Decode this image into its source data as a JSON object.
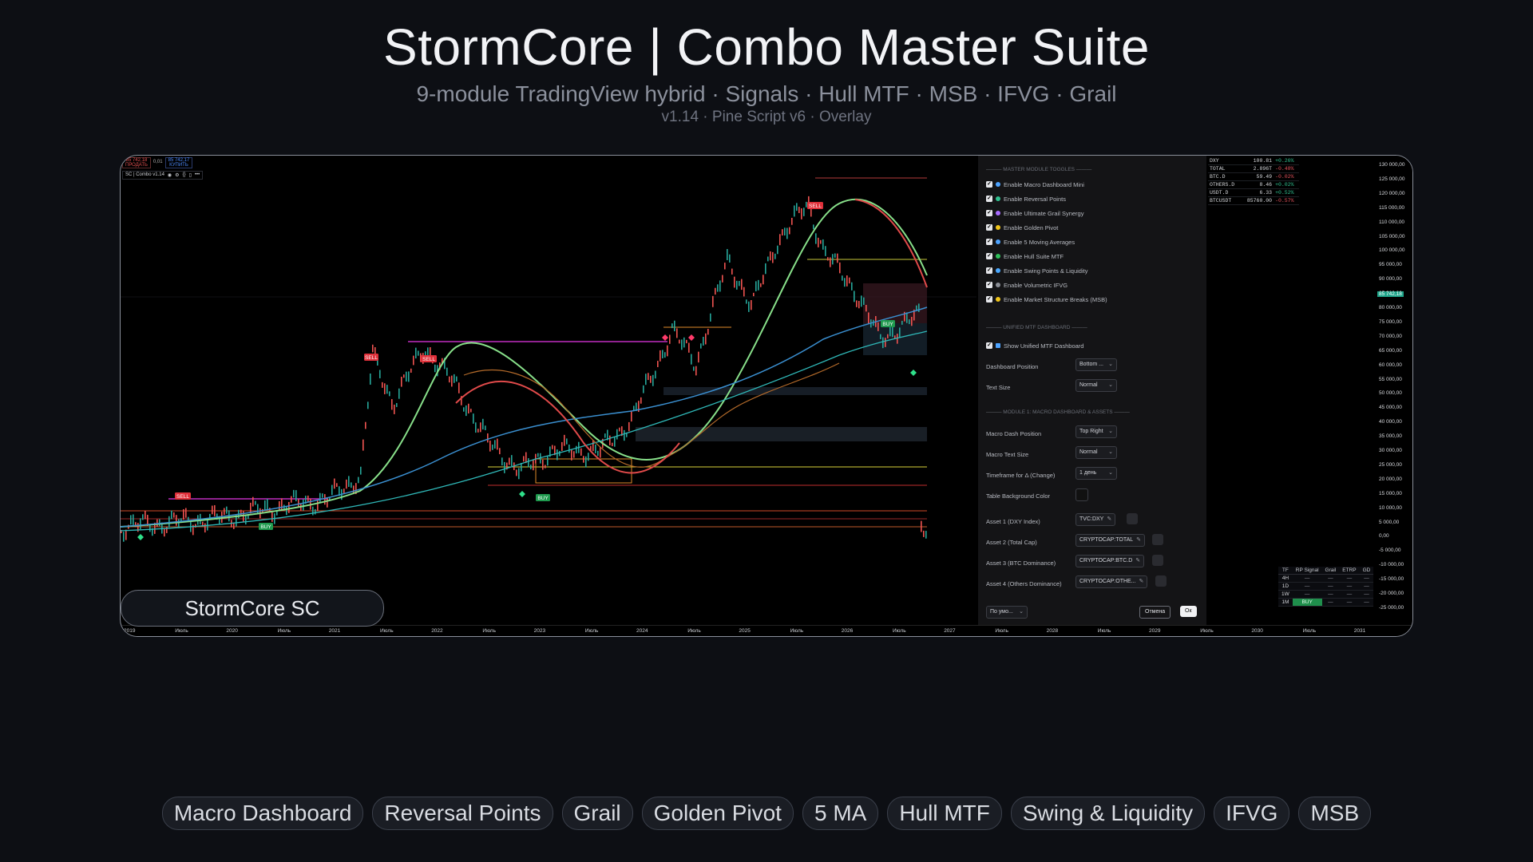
{
  "hero": {
    "title": "StormCore | Combo Master Suite",
    "subtitle": "9-module TradingView hybrid  ·  Signals · Hull MTF · MSB · IFVG · Grail",
    "meta": "v1.14  ·  Pine Script v6  ·  Overlay"
  },
  "tv": {
    "sell_price": "85 742,18",
    "sell_label": "ПРОДАТЬ",
    "spread": "0,01",
    "buy_price": "85 742,17",
    "buy_label": "КУПИТЬ",
    "indicator": "SC | Combo v1.14",
    "current_price_tag": "85 742,18"
  },
  "chart_signals": [
    "SELL",
    "SELL",
    "SELL",
    "SELL",
    "BUY",
    "BUY",
    "BUY"
  ],
  "settings": {
    "sec_master": "——— MASTER MODULE TOGGLES ———",
    "toggles": [
      {
        "icon": "chart-icon",
        "color": "#4da3ff",
        "label": "Enable Macro Dashboard Mini"
      },
      {
        "icon": "circle-green-icon",
        "color": "#2fbf8e",
        "label": "Enable Reversal Points"
      },
      {
        "icon": "square-purple-icon",
        "color": "#a86bff",
        "label": "Enable Ultimate Grail Synergy"
      },
      {
        "icon": "circle-yellow-icon",
        "color": "#f0c419",
        "label": "Enable Golden Pivot"
      },
      {
        "icon": "chart-icon",
        "color": "#4da3ff",
        "label": "Enable 5 Moving Averages"
      },
      {
        "icon": "square-green-icon",
        "color": "#2fbf5a",
        "label": "Enable Hull Suite MTF"
      },
      {
        "icon": "drop-icon",
        "color": "#4aa8ff",
        "label": "Enable Swing Points & Liquidity"
      },
      {
        "icon": "circle-grey-icon",
        "color": "#8a8d95",
        "label": "Enable Volumetric IFVG"
      },
      {
        "icon": "bolt-icon",
        "color": "#f0c419",
        "label": "Enable Market Structure Breaks (MSB)"
      }
    ],
    "sec_mtf": "——— UNIFIED MTF DASHBOARD ———",
    "show_mtf": "Show Unified MTF Dashboard",
    "dash_pos_label": "Dashboard Position",
    "dash_pos_value": "Bottom ...",
    "text_size_label": "Text Size",
    "text_size_value": "Normal",
    "sec_macro": "——— MODULE 1: MACRO DASHBOARD & ASSETS ———",
    "macro_pos_label": "Macro Dash Position",
    "macro_pos_value": "Top Right",
    "macro_text_label": "Macro Text Size",
    "macro_text_value": "Normal",
    "tf_label": "Timeframe for Δ (Change)",
    "tf_value": "1 день",
    "bg_label": "Table Background Color",
    "assets": [
      {
        "label": "Asset 1 (DXY Index)",
        "value": "TVC:DXY"
      },
      {
        "label": "Asset 2 (Total Cap)",
        "value": "CRYPTOCAP:TOTAL"
      },
      {
        "label": "Asset 3 (BTC Dominance)",
        "value": "CRYPTOCAP:BTC.D"
      },
      {
        "label": "Asset 4 (Others Dominance)",
        "value": "CRYPTOCAP:OTHE..."
      }
    ],
    "defaults": "По умо...",
    "cancel": "Отмена",
    "ok": "Ок"
  },
  "macro": [
    {
      "name": "DXY",
      "value": "100.81",
      "change": "+0.26%",
      "dir": "pos"
    },
    {
      "name": "TOTAL",
      "value": "2.896T",
      "change": "-0.48%",
      "dir": "neg"
    },
    {
      "name": "BTC.D",
      "value": "59.49",
      "change": "-0.02%",
      "dir": "neg"
    },
    {
      "name": "OTHERS.D",
      "value": "8.46",
      "change": "+0.02%",
      "dir": "pos"
    },
    {
      "name": "USDT.D",
      "value": "6.33",
      "change": "+0.52%",
      "dir": "pos"
    },
    {
      "name": "BTCUSDT",
      "value": "85760.00",
      "change": "-0.57%",
      "dir": "neg"
    }
  ],
  "yaxis": [
    "130 000,00",
    "125 000,00",
    "120 000,00",
    "115 000,00",
    "110 000,00",
    "105 000,00",
    "100 000,00",
    "95 000,00",
    "90 000,00",
    "85 000,00",
    "80 000,00",
    "75 000,00",
    "70 000,00",
    "65 000,00",
    "60 000,00",
    "55 000,00",
    "50 000,00",
    "45 000,00",
    "40 000,00",
    "35 000,00",
    "30 000,00",
    "25 000,00",
    "20 000,00",
    "15 000,00",
    "10 000,00",
    "5 000,00",
    "0,00",
    "-5 000,00",
    "-10 000,00",
    "-15 000,00",
    "-20 000,00",
    "-25 000,00"
  ],
  "mtf": {
    "headers": [
      "TF",
      "RP Signal",
      "Grail",
      "ETRP",
      "GD"
    ],
    "rows": [
      [
        "4H",
        "—",
        "—",
        "—",
        "—"
      ],
      [
        "1D",
        "—",
        "—",
        "—",
        "—"
      ],
      [
        "1W",
        "—",
        "—",
        "—",
        "—"
      ],
      [
        "1M",
        "BUY",
        "—",
        "—",
        "—"
      ]
    ]
  },
  "xaxis": [
    "2019",
    "Июль",
    "2020",
    "Июль",
    "2021",
    "Июль",
    "2022",
    "Июль",
    "2023",
    "Июль",
    "2024",
    "Июль",
    "2025",
    "Июль",
    "2026",
    "Июль",
    "2027",
    "Июль",
    "2028",
    "Июль",
    "2029",
    "Июль",
    "2030",
    "Июль",
    "2031"
  ],
  "brand": "StormCore  SC",
  "chips": [
    "Macro Dashboard",
    "Reversal Points",
    "Grail",
    "Golden Pivot",
    "5 MA",
    "Hull MTF",
    "Swing & Liquidity",
    "IFVG",
    "MSB"
  ]
}
